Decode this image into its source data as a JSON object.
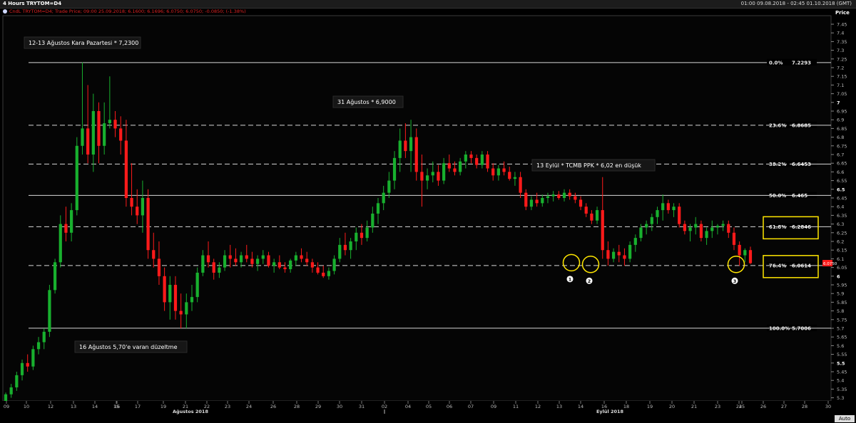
{
  "header": {
    "title": "4 Hours TRYTOM=D4",
    "range": "01:00 09.08.2018 - 02:45 01.10.2018 (GMT)",
    "legend": "CndL TRYTOM=D4; Trade Price; 09:00 25.09.2018; 6.1600; 6.1696; 6.0750; 6.0750; -0.0850; (-1.38%)",
    "price_label": "Price",
    "auto_label": "Auto",
    "last_price": "6.0750"
  },
  "colors": {
    "up": "#18b02e",
    "down": "#ff1a1a",
    "highlight": "#ffe600",
    "bg": "#000000",
    "grid": "#2a2a2a"
  },
  "chart_data": {
    "type": "candlestick",
    "y_axis": {
      "min": 5.25,
      "max": 7.5,
      "step": 0.05,
      "ticks": [
        "7.45",
        "7.4",
        "7.35",
        "7.3",
        "7.25",
        "7.2",
        "7.15",
        "7.1",
        "7.05",
        "7",
        "6.95",
        "6.9",
        "6.85",
        "6.8",
        "6.75",
        "6.7",
        "6.65",
        "6.6",
        "6.55",
        "6.5",
        "6.45",
        "6.4",
        "6.35",
        "6.3",
        "6.25",
        "6.2",
        "6.15",
        "6.1",
        "6.05",
        "6",
        "5.95",
        "5.9",
        "5.85",
        "5.8",
        "5.75",
        "5.7",
        "5.65",
        "5.6",
        "5.55",
        "5.5",
        "5.45",
        "5.4",
        "5.35",
        "5.3"
      ]
    },
    "x_axis": {
      "day_labels": [
        {
          "day": "09",
          "label": "09"
        },
        {
          "day": "10",
          "label": "10"
        },
        {
          "day": "12",
          "label": "12"
        },
        {
          "day": "13",
          "label": "13"
        },
        {
          "day": "14",
          "label": "14"
        },
        {
          "day": "15",
          "label": "15"
        },
        {
          "day": "16",
          "label": "16"
        },
        {
          "day": "17",
          "label": "17"
        },
        {
          "day": "19",
          "label": "19"
        },
        {
          "day": "21",
          "label": "21"
        },
        {
          "day": "22",
          "label": "22"
        },
        {
          "day": "23",
          "label": "23"
        },
        {
          "day": "24",
          "label": "24"
        },
        {
          "day": "26",
          "label": "26"
        },
        {
          "day": "28",
          "label": "28"
        },
        {
          "day": "29",
          "label": "29"
        },
        {
          "day": "30",
          "label": "30"
        },
        {
          "day": "31",
          "label": "31"
        },
        {
          "day": "S02",
          "label": "02"
        },
        {
          "day": "S04",
          "label": "04"
        },
        {
          "day": "S05",
          "label": "05"
        },
        {
          "day": "S06",
          "label": "06"
        },
        {
          "day": "S07",
          "label": "07"
        },
        {
          "day": "S09",
          "label": "09"
        },
        {
          "day": "S11",
          "label": "11"
        },
        {
          "day": "S12",
          "label": "12"
        },
        {
          "day": "S13",
          "label": "13"
        },
        {
          "day": "S14",
          "label": "14"
        },
        {
          "day": "S16",
          "label": "16"
        },
        {
          "day": "S18",
          "label": "18"
        },
        {
          "day": "S19",
          "label": "19"
        },
        {
          "day": "S20",
          "label": "20"
        },
        {
          "day": "S21",
          "label": "21"
        },
        {
          "day": "S23",
          "label": "23"
        },
        {
          "day": "S24",
          "label": "24"
        },
        {
          "day": "S25",
          "label": "25"
        },
        {
          "day": "S26",
          "label": "26"
        },
        {
          "day": "S27",
          "label": "27"
        },
        {
          "day": "S28",
          "label": "28"
        },
        {
          "day": "S30",
          "label": "30"
        }
      ],
      "month_labels": [
        {
          "text": "Ağustos 2018"
        },
        {
          "text": "Eylül 2018"
        }
      ]
    },
    "fibonacci": [
      {
        "pct": "0.0%",
        "value": 7.2293,
        "label": "7.2293",
        "style": "solid"
      },
      {
        "pct": "23.6%",
        "value": 6.8685,
        "label": "6.8685",
        "style": "dashed"
      },
      {
        "pct": "38.2%",
        "value": 6.6453,
        "label": "6.6453",
        "style": "dashed"
      },
      {
        "pct": "50.0%",
        "value": 6.465,
        "label": "6.465",
        "style": "solid"
      },
      {
        "pct": "61.8%",
        "value": 6.2846,
        "label": "6.2846",
        "style": "dashed"
      },
      {
        "pct": "76.4%",
        "value": 6.0614,
        "label": "6.0614",
        "style": "dashed"
      },
      {
        "pct": "100.0%",
        "value": 5.7006,
        "label": "5.7006",
        "style": "solid"
      }
    ],
    "annotations": [
      {
        "text": "12-13 Ağustos Kara Pazartesi  * 7,2300"
      },
      {
        "text": "31 Ağustos * 6,9000"
      },
      {
        "text": "13 Eylül * TCMB PPK   * 6,02 en düşük"
      },
      {
        "text": "16 Ağustos 5,70'e varan düzeltme"
      }
    ],
    "markers": [
      {
        "label": "1",
        "price": 6.09
      },
      {
        "label": "2",
        "price": 6.08
      },
      {
        "label": "3",
        "price": 6.08
      }
    ],
    "candles": [
      [
        5.27,
        5.33,
        5.25,
        5.32
      ],
      [
        5.32,
        5.38,
        5.3,
        5.36
      ],
      [
        5.36,
        5.45,
        5.34,
        5.43
      ],
      [
        5.43,
        5.52,
        5.4,
        5.5
      ],
      [
        5.5,
        5.55,
        5.45,
        5.48
      ],
      [
        5.48,
        5.6,
        5.46,
        5.58
      ],
      [
        5.58,
        5.65,
        5.55,
        5.62
      ],
      [
        5.62,
        5.7,
        5.58,
        5.68
      ],
      [
        5.68,
        5.95,
        5.65,
        5.92
      ],
      [
        5.92,
        6.1,
        5.9,
        6.08
      ],
      [
        6.08,
        6.35,
        6.05,
        6.3
      ],
      [
        6.3,
        6.4,
        6.2,
        6.25
      ],
      [
        6.25,
        6.42,
        6.2,
        6.38
      ],
      [
        6.38,
        6.8,
        6.35,
        6.75
      ],
      [
        6.75,
        7.23,
        6.7,
        6.85
      ],
      [
        6.85,
        7.1,
        6.65,
        6.7
      ],
      [
        6.7,
        7.05,
        6.6,
        6.95
      ],
      [
        6.95,
        7.0,
        6.65,
        6.75
      ],
      [
        6.75,
        7.0,
        6.7,
        6.88
      ],
      [
        6.88,
        7.15,
        6.85,
        6.9
      ],
      [
        6.9,
        6.95,
        6.8,
        6.85
      ],
      [
        6.85,
        6.92,
        6.7,
        6.78
      ],
      [
        6.78,
        6.9,
        6.4,
        6.45
      ],
      [
        6.45,
        6.65,
        6.35,
        6.4
      ],
      [
        6.4,
        6.5,
        6.3,
        6.35
      ],
      [
        6.35,
        6.55,
        6.25,
        6.45
      ],
      [
        6.45,
        6.5,
        6.1,
        6.15
      ],
      [
        6.15,
        6.25,
        6.05,
        6.1
      ],
      [
        6.1,
        6.2,
        5.95,
        6.0
      ],
      [
        6.0,
        6.05,
        5.8,
        5.85
      ],
      [
        5.85,
        6.0,
        5.75,
        5.95
      ],
      [
        5.95,
        6.0,
        5.75,
        5.8
      ],
      [
        5.8,
        5.9,
        5.7,
        5.78
      ],
      [
        5.78,
        5.9,
        5.7,
        5.85
      ],
      [
        5.85,
        5.95,
        5.8,
        5.88
      ],
      [
        5.88,
        6.05,
        5.85,
        6.02
      ],
      [
        6.02,
        6.15,
        6.0,
        6.12
      ],
      [
        6.12,
        6.2,
        6.05,
        6.08
      ],
      [
        6.08,
        6.1,
        5.98,
        6.02
      ],
      [
        6.02,
        6.08,
        5.99,
        6.05
      ],
      [
        6.05,
        6.15,
        6.03,
        6.12
      ],
      [
        6.12,
        6.18,
        6.05,
        6.1
      ],
      [
        6.1,
        6.16,
        6.06,
        6.08
      ],
      [
        6.08,
        6.14,
        6.05,
        6.12
      ],
      [
        6.12,
        6.18,
        6.08,
        6.1
      ],
      [
        6.1,
        6.14,
        6.05,
        6.07
      ],
      [
        6.07,
        6.12,
        6.03,
        6.1
      ],
      [
        6.1,
        6.15,
        6.07,
        6.12
      ],
      [
        6.12,
        6.14,
        6.05,
        6.06
      ],
      [
        6.06,
        6.1,
        6.02,
        6.08
      ],
      [
        6.08,
        6.12,
        6.04,
        6.05
      ],
      [
        6.05,
        6.08,
        6.02,
        6.04
      ],
      [
        6.04,
        6.1,
        6.02,
        6.09
      ],
      [
        6.09,
        6.14,
        6.06,
        6.12
      ],
      [
        6.12,
        6.16,
        6.08,
        6.1
      ],
      [
        6.1,
        6.14,
        6.06,
        6.08
      ],
      [
        6.08,
        6.1,
        6.02,
        6.05
      ],
      [
        6.05,
        6.08,
        6.01,
        6.02
      ],
      [
        6.02,
        6.06,
        5.99,
        6.0
      ],
      [
        6.0,
        6.05,
        5.98,
        6.03
      ],
      [
        6.03,
        6.12,
        6.01,
        6.1
      ],
      [
        6.1,
        6.22,
        6.08,
        6.18
      ],
      [
        6.18,
        6.25,
        6.12,
        6.15
      ],
      [
        6.15,
        6.22,
        6.1,
        6.2
      ],
      [
        6.2,
        6.28,
        6.15,
        6.25
      ],
      [
        6.25,
        6.3,
        6.18,
        6.22
      ],
      [
        6.22,
        6.32,
        6.2,
        6.28
      ],
      [
        6.28,
        6.4,
        6.25,
        6.36
      ],
      [
        6.36,
        6.45,
        6.3,
        6.42
      ],
      [
        6.42,
        6.52,
        6.38,
        6.48
      ],
      [
        6.48,
        6.6,
        6.45,
        6.55
      ],
      [
        6.55,
        6.72,
        6.5,
        6.68
      ],
      [
        6.68,
        6.85,
        6.6,
        6.78
      ],
      [
        6.78,
        6.88,
        6.68,
        6.72
      ],
      [
        6.72,
        6.9,
        6.6,
        6.8
      ],
      [
        6.8,
        6.85,
        6.55,
        6.6
      ],
      [
        6.6,
        6.7,
        6.4,
        6.55
      ],
      [
        6.55,
        6.62,
        6.5,
        6.58
      ],
      [
        6.58,
        6.66,
        6.54,
        6.6
      ],
      [
        6.6,
        6.64,
        6.52,
        6.55
      ],
      [
        6.55,
        6.68,
        6.53,
        6.65
      ],
      [
        6.65,
        6.7,
        6.6,
        6.62
      ],
      [
        6.62,
        6.66,
        6.58,
        6.6
      ],
      [
        6.6,
        6.68,
        6.58,
        6.66
      ],
      [
        6.66,
        6.72,
        6.62,
        6.7
      ],
      [
        6.7,
        6.72,
        6.65,
        6.68
      ],
      [
        6.68,
        6.7,
        6.62,
        6.64
      ],
      [
        6.64,
        6.72,
        6.62,
        6.7
      ],
      [
        6.7,
        6.72,
        6.6,
        6.62
      ],
      [
        6.62,
        6.65,
        6.55,
        6.58
      ],
      [
        6.58,
        6.64,
        6.55,
        6.62
      ],
      [
        6.62,
        6.66,
        6.58,
        6.6
      ],
      [
        6.6,
        6.63,
        6.55,
        6.56
      ],
      [
        6.56,
        6.6,
        6.52,
        6.57
      ],
      [
        6.57,
        6.6,
        6.45,
        6.48
      ],
      [
        6.48,
        6.5,
        6.38,
        6.4
      ],
      [
        6.4,
        6.46,
        6.38,
        6.44
      ],
      [
        6.44,
        6.48,
        6.4,
        6.42
      ],
      [
        6.42,
        6.47,
        6.4,
        6.45
      ],
      [
        6.45,
        6.48,
        6.42,
        6.46
      ],
      [
        6.46,
        6.49,
        6.43,
        6.47
      ],
      [
        6.47,
        6.49,
        6.44,
        6.45
      ],
      [
        6.45,
        6.5,
        6.43,
        6.48
      ],
      [
        6.48,
        6.5,
        6.44,
        6.46
      ],
      [
        6.46,
        6.48,
        6.42,
        6.44
      ],
      [
        6.44,
        6.46,
        6.38,
        6.4
      ],
      [
        6.4,
        6.42,
        6.34,
        6.36
      ],
      [
        6.36,
        6.38,
        6.3,
        6.32
      ],
      [
        6.32,
        6.4,
        6.3,
        6.38
      ],
      [
        6.38,
        6.57,
        6.1,
        6.15
      ],
      [
        6.15,
        6.2,
        6.06,
        6.1
      ],
      [
        6.1,
        6.16,
        6.08,
        6.14
      ],
      [
        6.14,
        6.18,
        6.08,
        6.12
      ],
      [
        6.12,
        6.16,
        6.06,
        6.1
      ],
      [
        6.1,
        6.2,
        6.08,
        6.18
      ],
      [
        6.18,
        6.24,
        6.14,
        6.22
      ],
      [
        6.22,
        6.3,
        6.2,
        6.28
      ],
      [
        6.28,
        6.32,
        6.24,
        6.3
      ],
      [
        6.3,
        6.36,
        6.26,
        6.34
      ],
      [
        6.34,
        6.4,
        6.3,
        6.38
      ],
      [
        6.38,
        6.47,
        6.32,
        6.42
      ],
      [
        6.42,
        6.44,
        6.36,
        6.38
      ],
      [
        6.38,
        6.42,
        6.34,
        6.4
      ],
      [
        6.4,
        6.42,
        6.28,
        6.3
      ],
      [
        6.3,
        6.32,
        6.24,
        6.26
      ],
      [
        6.26,
        6.3,
        6.2,
        6.28
      ],
      [
        6.28,
        6.34,
        6.24,
        6.3
      ],
      [
        6.3,
        6.32,
        6.2,
        6.22
      ],
      [
        6.22,
        6.28,
        6.18,
        6.26
      ],
      [
        6.26,
        6.32,
        6.22,
        6.28
      ],
      [
        6.28,
        6.3,
        6.24,
        6.29
      ],
      [
        6.29,
        6.32,
        6.26,
        6.3
      ],
      [
        6.3,
        6.32,
        6.22,
        6.25
      ],
      [
        6.25,
        6.28,
        6.15,
        6.18
      ],
      [
        6.18,
        6.2,
        6.06,
        6.12
      ],
      [
        6.12,
        6.16,
        6.08,
        6.15
      ],
      [
        6.15,
        6.17,
        6.07,
        6.075
      ]
    ]
  }
}
